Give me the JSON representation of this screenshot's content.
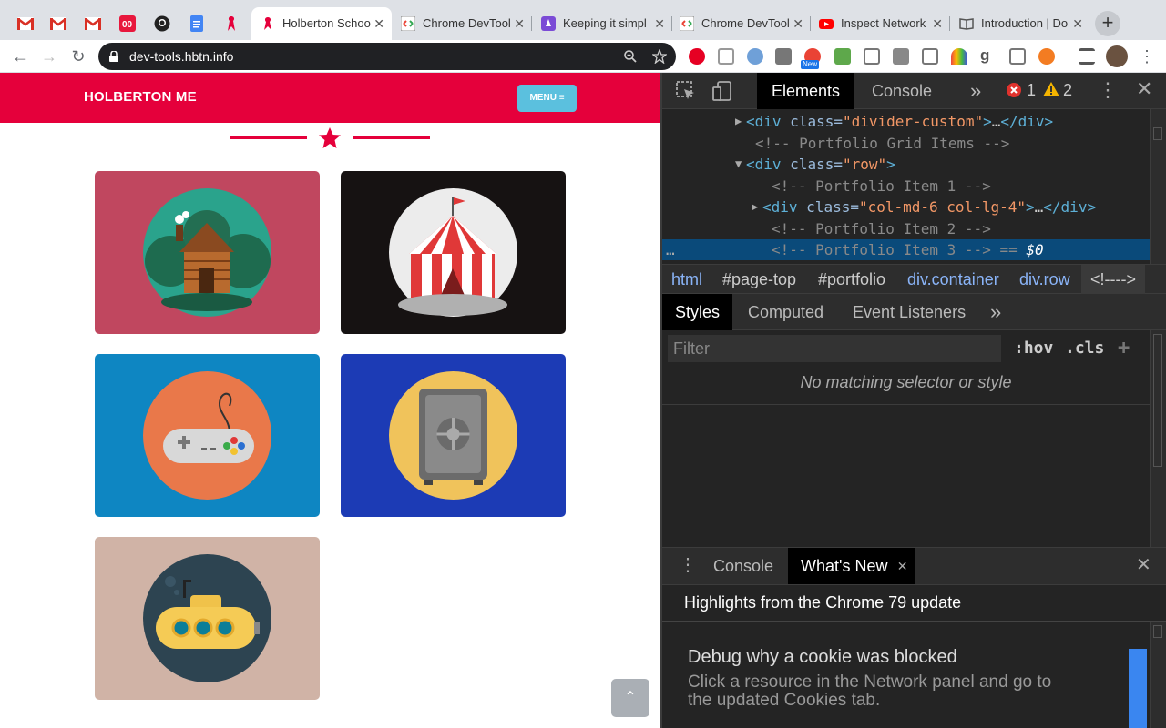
{
  "browser": {
    "tabs": [
      {
        "title": "Holberton Schoo",
        "active": true
      },
      {
        "title": "Chrome DevTool",
        "active": false
      },
      {
        "title": "Keeping it simpl",
        "active": false
      },
      {
        "title": "Chrome DevTool",
        "active": false
      },
      {
        "title": "Inspect Network",
        "active": false
      },
      {
        "title": "Introduction | Do",
        "active": false
      }
    ],
    "new_tab_label": "+",
    "url": "dev-tools.hbtn.info",
    "ext_badge": "New"
  },
  "page": {
    "brand": "HOLBERTON ME",
    "menu_label": "MENU ≡",
    "back_to_top": "⌃",
    "colors": {
      "accent": "#e5003b",
      "menu": "#5bc0de"
    },
    "portfolio": [
      {
        "icon": "cabin-icon",
        "bg": "#c0475f"
      },
      {
        "icon": "circus-tent-icon",
        "bg": "#161212"
      },
      {
        "icon": "game-controller-icon",
        "bg": "#0e86c2"
      },
      {
        "icon": "safe-icon",
        "bg": "#1c3bb5"
      },
      {
        "icon": "submarine-icon",
        "bg": "#d0b3a6"
      }
    ]
  },
  "devtools": {
    "tabs": {
      "elements": "Elements",
      "console": "Console",
      "more": "»"
    },
    "errors": "1",
    "warnings": "2",
    "dom": [
      {
        "prefix": "▶",
        "parts": [
          [
            "tag",
            "<div "
          ],
          [
            "attr",
            "class="
          ],
          [
            "val",
            "\"divider-custom\""
          ],
          [
            "tag",
            ">"
          ],
          [
            "txt",
            "…"
          ],
          [
            "tag",
            "</div>"
          ]
        ]
      },
      {
        "prefix": "",
        "parts": [
          [
            "cmt",
            "<!-- Portfolio Grid Items -->"
          ]
        ]
      },
      {
        "prefix": "▼",
        "parts": [
          [
            "tag",
            "<div "
          ],
          [
            "attr",
            "class="
          ],
          [
            "val",
            "\"row\""
          ],
          [
            "tag",
            ">"
          ]
        ]
      },
      {
        "prefix": "",
        "parts": [
          [
            "cmt",
            "<!-- Portfolio Item 1 -->"
          ]
        ]
      },
      {
        "prefix": "▶",
        "parts": [
          [
            "tag",
            "<div "
          ],
          [
            "attr",
            "class="
          ],
          [
            "val",
            "\"col-md-6 col-lg-4\""
          ],
          [
            "tag",
            ">"
          ],
          [
            "txt",
            "…"
          ],
          [
            "tag",
            "</div>"
          ]
        ]
      },
      {
        "prefix": "",
        "parts": [
          [
            "cmt",
            "<!-- Portfolio Item 2 -->"
          ]
        ]
      },
      {
        "prefix": "",
        "parts": [
          [
            "cmt",
            "<!-- Portfolio Item 3 --> == "
          ],
          [
            "txt",
            "$0"
          ]
        ]
      }
    ],
    "breadcrumbs": [
      "html",
      "#page-top",
      "#portfolio",
      "div.container",
      "div.row",
      "<!---->"
    ],
    "styles_tabs": {
      "styles": "Styles",
      "computed": "Computed",
      "listeners": "Event Listeners",
      "more": "»"
    },
    "filter_placeholder": "Filter",
    "hov": ":hov",
    "cls": ".cls",
    "add": "+",
    "no_match": "No matching selector or style",
    "drawer": {
      "console": "Console",
      "whats_new": "What's New",
      "heading": "Highlights from the Chrome 79 update",
      "card_title": "Debug why a cookie was blocked",
      "card_desc": "Click a resource in the Network panel and go to the updated Cookies tab."
    }
  }
}
